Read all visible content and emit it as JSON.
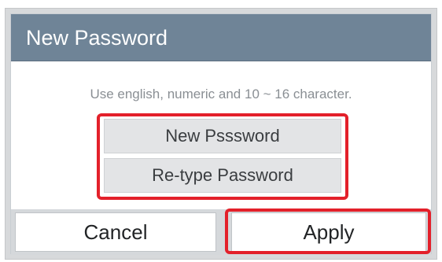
{
  "dialog": {
    "title": "New Password",
    "hint": "Use english, numeric and 10 ~ 16 character.",
    "fields": {
      "new_password_placeholder": "New Psssword",
      "retype_password_placeholder": "Re-type Password"
    },
    "buttons": {
      "cancel": "Cancel",
      "apply": "Apply"
    }
  },
  "colors": {
    "titlebar": "#6f8497",
    "highlight": "#e3202a"
  }
}
